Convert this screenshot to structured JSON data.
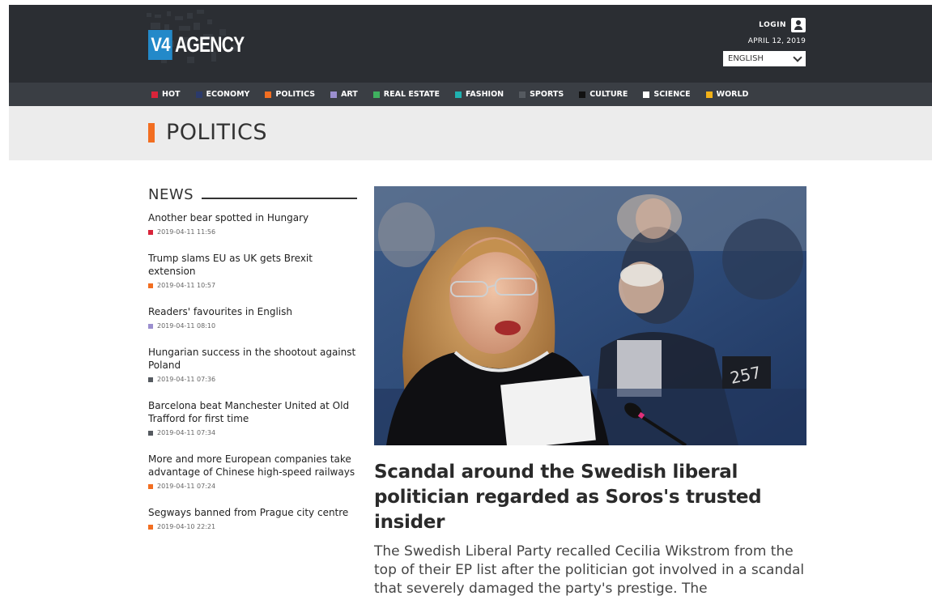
{
  "header": {
    "logo_box": "V4",
    "logo_text": "AGENCY",
    "login_label": "LOGIN",
    "date": "APRIL 12, 2019",
    "language": "ENGLISH"
  },
  "nav": {
    "items": [
      {
        "label": "HOT",
        "color": "#d9243a"
      },
      {
        "label": "ECONOMY",
        "color": "#2b3a6b"
      },
      {
        "label": "POLITICS",
        "color": "#f26e21"
      },
      {
        "label": "ART",
        "color": "#9b8fcf"
      },
      {
        "label": "REAL ESTATE",
        "color": "#3fb05f"
      },
      {
        "label": "FASHION",
        "color": "#1fb1b0"
      },
      {
        "label": "SPORTS",
        "color": "#555a60"
      },
      {
        "label": "CULTURE",
        "color": "#111111"
      },
      {
        "label": "SCIENCE",
        "color": "#ffffff"
      },
      {
        "label": "WORLD",
        "color": "#f2b118"
      }
    ]
  },
  "section": {
    "title": "POLITICS",
    "accent": "#f26e21"
  },
  "news": {
    "heading": "NEWS",
    "items": [
      {
        "title": "Another bear spotted in Hungary",
        "timestamp": "2019-04-11 11:56",
        "color": "#d9243a"
      },
      {
        "title": "Trump slams EU as UK gets Brexit extension",
        "timestamp": "2019-04-11 10:57",
        "color": "#f26e21"
      },
      {
        "title": "Readers' favourites in English",
        "timestamp": "2019-04-11 08:10",
        "color": "#9b8fcf"
      },
      {
        "title": "Hungarian success in the shootout against Poland",
        "timestamp": "2019-04-11 07:36",
        "color": "#555a60"
      },
      {
        "title": "Barcelona beat Manchester United at Old Trafford for first time",
        "timestamp": "2019-04-11 07:34",
        "color": "#555a60"
      },
      {
        "title": "More and more European companies take advantage of Chinese high-speed railways",
        "timestamp": "2019-04-11 07:24",
        "color": "#f26e21"
      },
      {
        "title": "Segways banned from Prague city centre",
        "timestamp": "2019-04-10 22:21",
        "color": "#f26e21"
      }
    ]
  },
  "featured": {
    "title": "Scandal around the Swedish liberal politician regarded as Soros's trusted insider",
    "lead": "The Swedish Liberal Party recalled Cecilia Wikstrom from the top of their EP list after the politician got involved in a scandal that severely damaged the party's prestige. The"
  }
}
